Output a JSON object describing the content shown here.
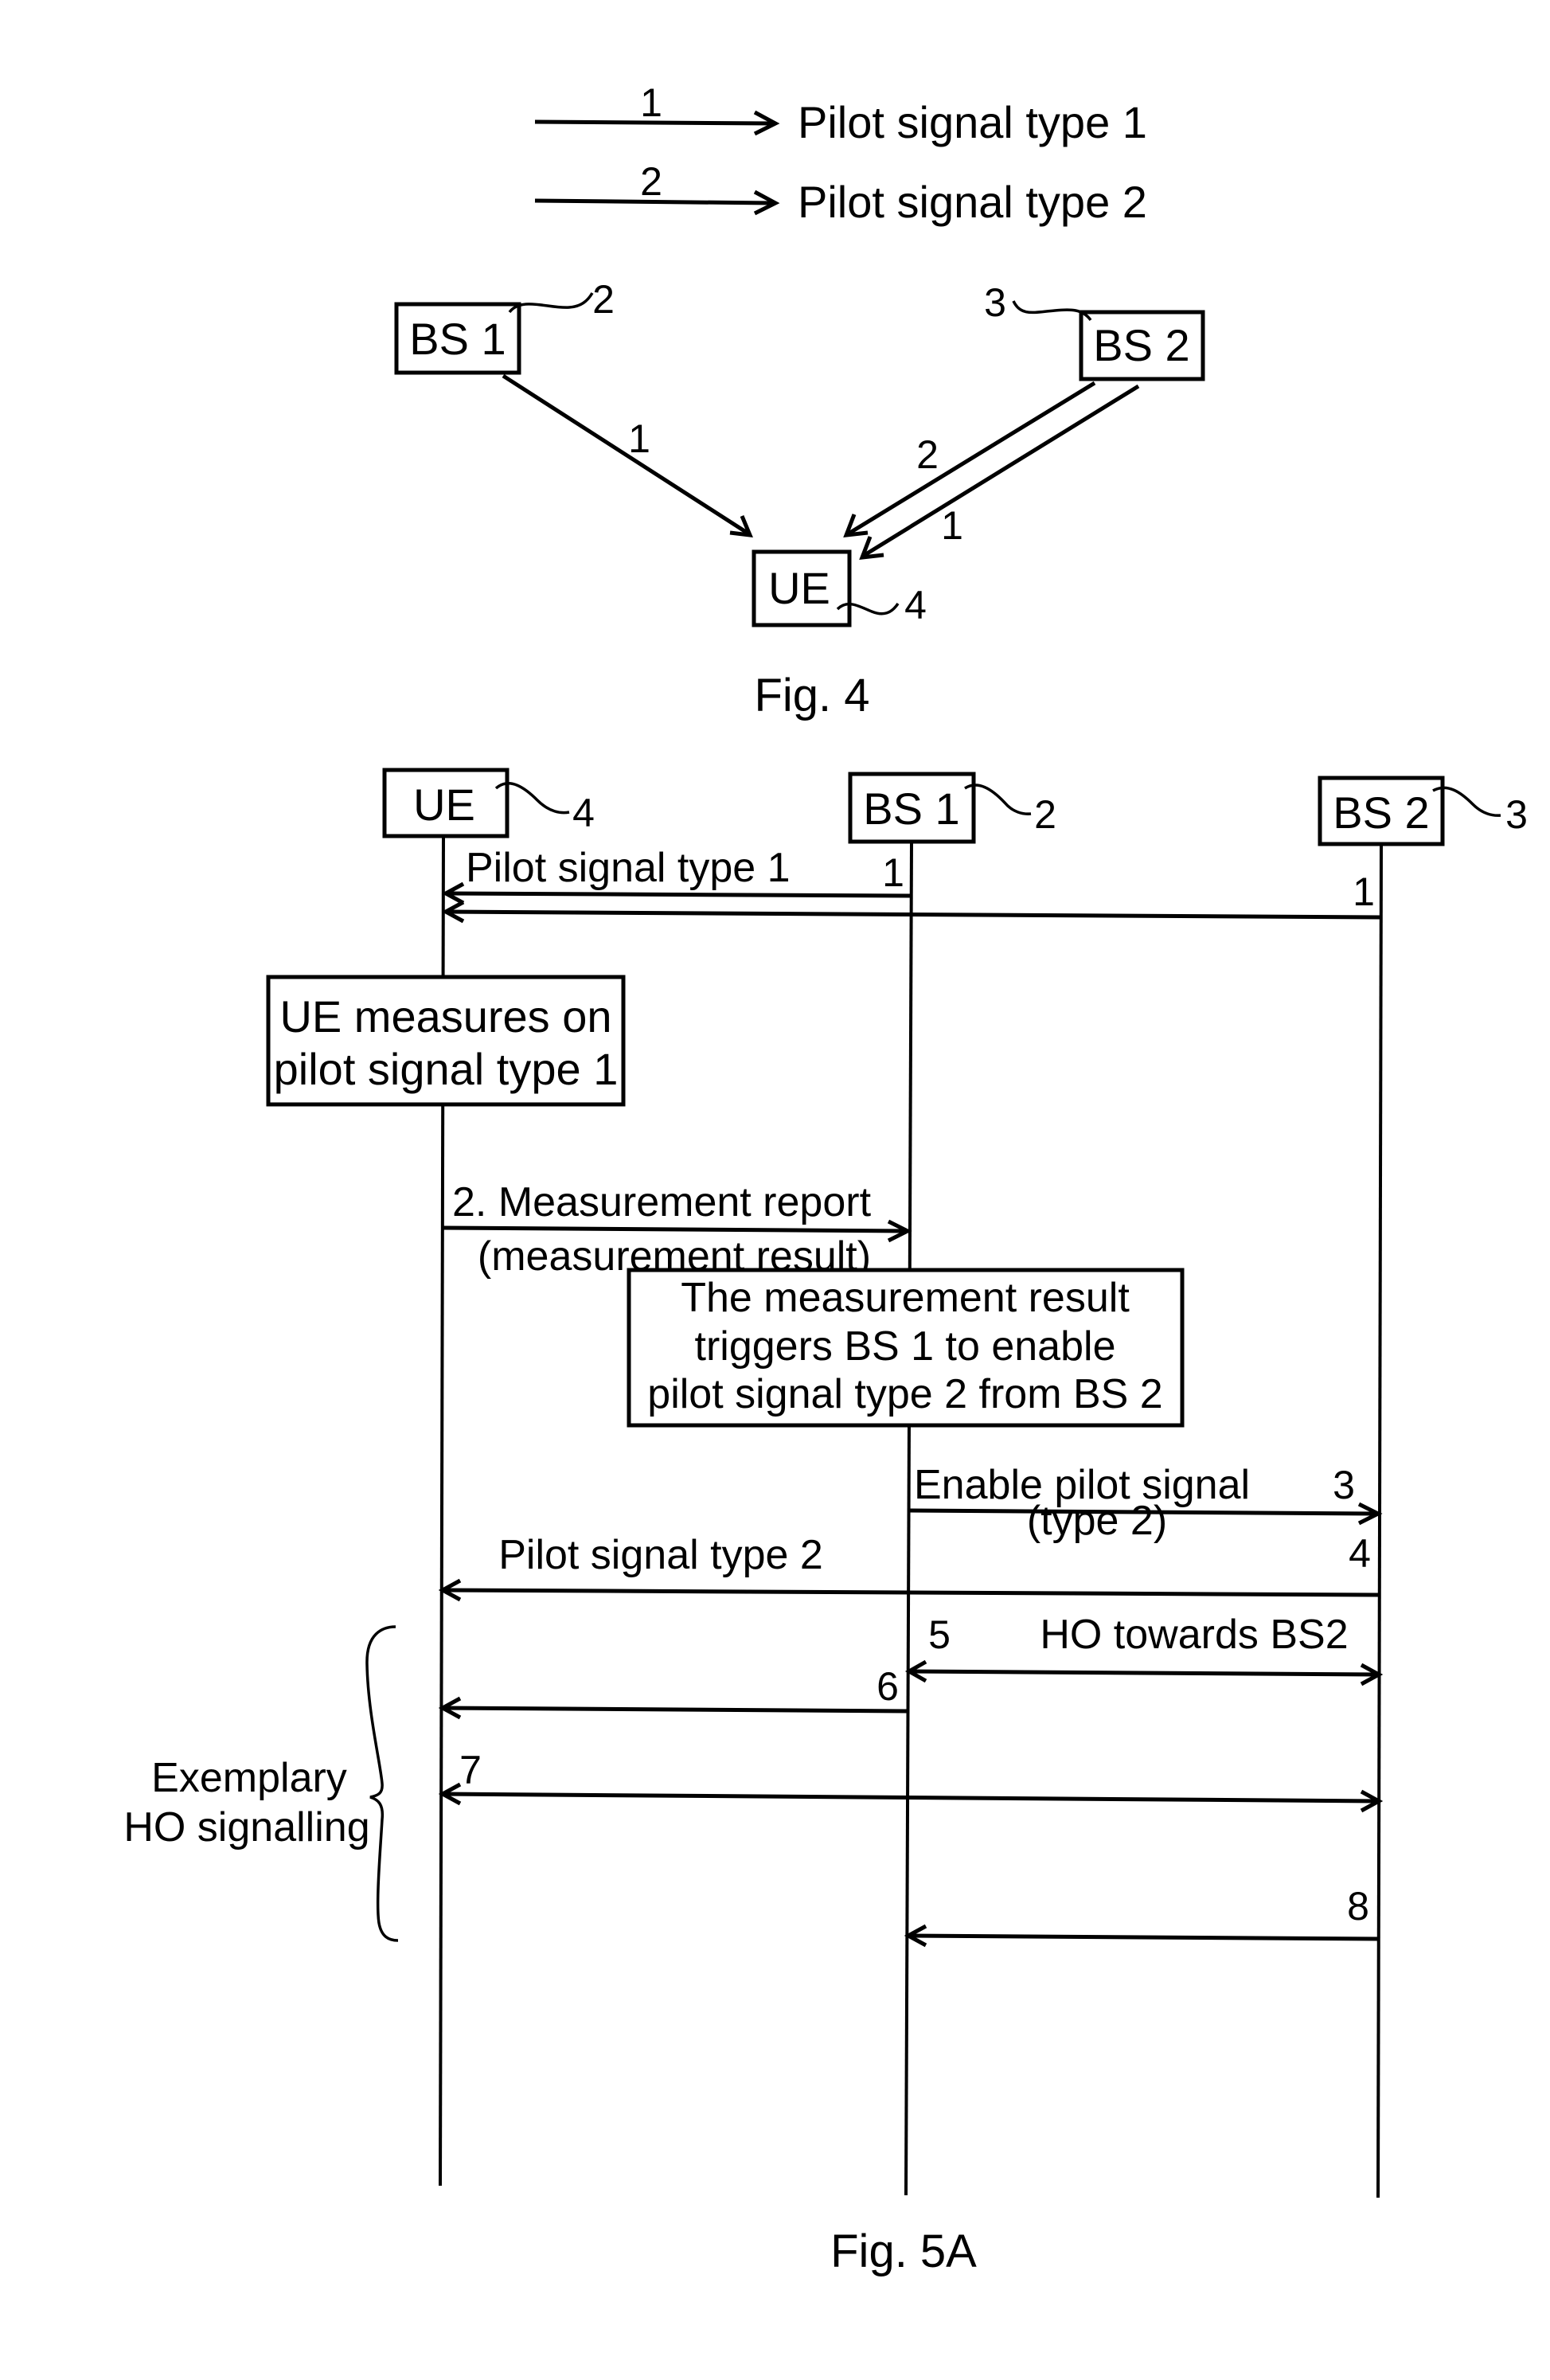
{
  "legend": {
    "items": [
      {
        "number": "1",
        "label": "Pilot signal type 1"
      },
      {
        "number": "2",
        "label": "Pilot signal type 2"
      }
    ]
  },
  "fig4": {
    "caption": "Fig. 4",
    "nodes": {
      "bs1": {
        "label": "BS 1",
        "ref": "2"
      },
      "bs2": {
        "label": "BS 2",
        "ref": "3"
      },
      "ue": {
        "label": "UE",
        "ref": "4"
      }
    },
    "links": [
      {
        "from": "BS 1",
        "to": "UE",
        "signal_type": "1"
      },
      {
        "from": "BS 2",
        "to": "UE",
        "signal_type": "2"
      },
      {
        "from": "BS 2",
        "to": "UE",
        "signal_type": "1"
      }
    ]
  },
  "fig5a": {
    "caption": "Fig. 5A",
    "participants": {
      "ue": {
        "label": "UE",
        "ref": "4"
      },
      "bs1": {
        "label": "BS 1",
        "ref": "2"
      },
      "bs2": {
        "label": "BS 2",
        "ref": "3"
      }
    },
    "notes": {
      "ue_measures": [
        "UE measures on",
        "pilot signal type 1"
      ],
      "trigger": [
        "The measurement result",
        "triggers BS 1 to enable",
        "pilot signal type 2 from BS 2"
      ]
    },
    "messages": {
      "m1": {
        "step": "1",
        "label": "Pilot signal type 1",
        "from": "BS 1",
        "to": "UE"
      },
      "m1b": {
        "step": "1",
        "from": "BS 2",
        "to": "UE"
      },
      "m2": {
        "label_line1": "2. Measurement report",
        "label_line2": "(measurement result)",
        "from": "UE",
        "to": "BS 1"
      },
      "m3": {
        "step": "3",
        "label_line1": "Enable pilot signal",
        "label_line2": "(type 2)",
        "from": "BS 1",
        "to": "BS 2"
      },
      "m4": {
        "step": "4",
        "label": "Pilot signal type 2",
        "from": "BS 2",
        "to": "UE"
      },
      "m5": {
        "step": "5",
        "label": "HO towards BS2",
        "between": [
          "BS 1",
          "BS 2"
        ]
      },
      "m6": {
        "step": "6",
        "from": "BS 1",
        "to": "UE"
      },
      "m7": {
        "step": "7",
        "between": [
          "UE",
          "BS 2"
        ]
      },
      "m8": {
        "step": "8",
        "from": "BS 2",
        "to": "BS 1"
      }
    },
    "brace_label": [
      "Exemplary",
      "HO signalling"
    ]
  }
}
